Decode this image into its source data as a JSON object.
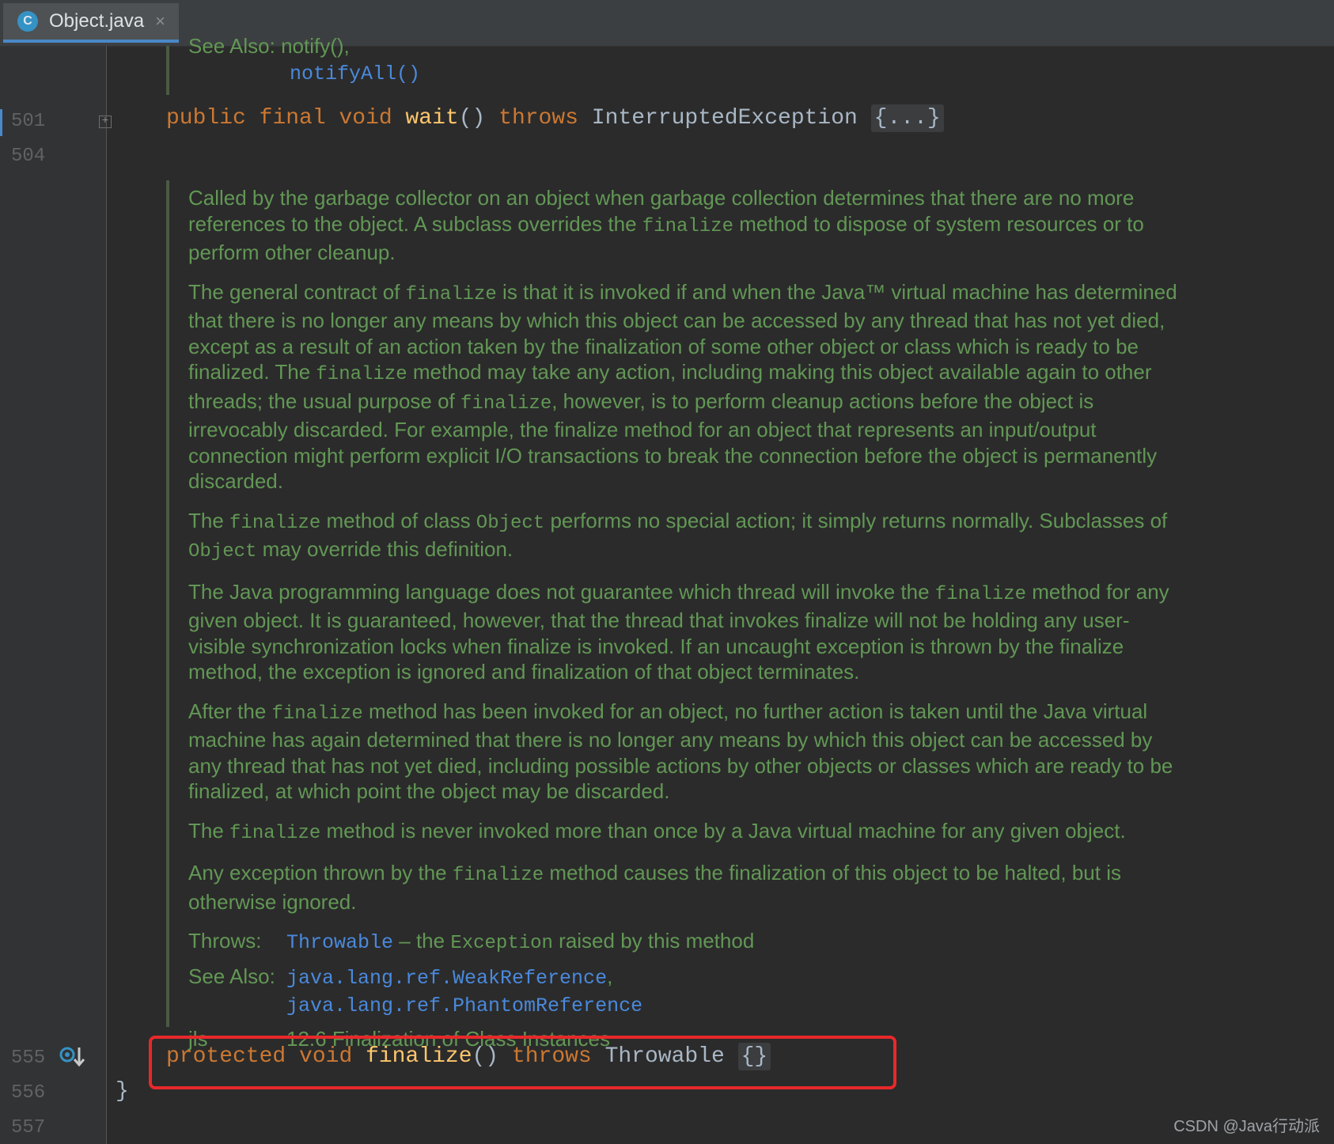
{
  "tab": {
    "icon_letter": "C",
    "title": "Object.java",
    "close": "×"
  },
  "gutter": {
    "lines": [
      "501",
      "504",
      "555",
      "556",
      "557"
    ]
  },
  "top_doc": {
    "see_also_prefix": "See Also: notify(),",
    "notify_all": "notifyAll()"
  },
  "wait_decl": {
    "kw_public": "public",
    "kw_final": "final",
    "kw_void": "void",
    "method": "wait",
    "parens": "()",
    "kw_throws": "throws",
    "exception": "InterruptedException",
    "folded": "{...}"
  },
  "doc": {
    "p1": [
      {
        "t": "Called by the garbage collector on an object when garbage collection determines that there are no more references to the object. A subclass overrides the "
      },
      {
        "c": "finalize"
      },
      {
        "t": " method to dispose of system resources or to perform other cleanup."
      }
    ],
    "p2": [
      {
        "t": "The general contract of "
      },
      {
        "c": "finalize"
      },
      {
        "t": " is that it is invoked if and when the Java™ virtual machine has determined that there is no longer any means by which this object can be accessed by any thread that has not yet died, except as a result of an action taken by the finalization of some other object or class which is ready to be finalized. The "
      },
      {
        "c": "finalize"
      },
      {
        "t": " method may take any action, including making this object available again to other threads; the usual purpose of "
      },
      {
        "c": "finalize"
      },
      {
        "t": ", however, is to perform cleanup actions before the object is irrevocably discarded. For example, the finalize method for an object that represents an input/output connection might perform explicit I/O transactions to break the connection before the object is permanently discarded."
      }
    ],
    "p3": [
      {
        "t": "The "
      },
      {
        "c": "finalize"
      },
      {
        "t": " method of class "
      },
      {
        "c": "Object"
      },
      {
        "t": " performs no special action; it simply returns normally. Subclasses of "
      },
      {
        "c": "Object"
      },
      {
        "t": " may override this definition."
      }
    ],
    "p4": [
      {
        "t": "The Java programming language does not guarantee which thread will invoke the "
      },
      {
        "c": "finalize"
      },
      {
        "t": " method for any given object. It is guaranteed, however, that the thread that invokes finalize will not be holding any user-visible synchronization locks when finalize is invoked. If an uncaught exception is thrown by the finalize method, the exception is ignored and finalization of that object terminates."
      }
    ],
    "p5": [
      {
        "t": "After the "
      },
      {
        "c": "finalize"
      },
      {
        "t": " method has been invoked for an object, no further action is taken until the Java virtual machine has again determined that there is no longer any means by which this object can be accessed by any thread that has not yet died, including possible actions by other objects or classes which are ready to be finalized, at which point the object may be discarded."
      }
    ],
    "p6": [
      {
        "t": "The "
      },
      {
        "c": "finalize"
      },
      {
        "t": " method is never invoked more than once by a Java virtual machine for any given object."
      }
    ],
    "p7": [
      {
        "t": "Any exception thrown by the "
      },
      {
        "c": "finalize"
      },
      {
        "t": " method causes the finalization of this object to be halted, but is otherwise ignored."
      }
    ],
    "throws_label": "Throws:",
    "throws_link": "Throwable",
    "throws_text": " – the ",
    "throws_code": "Exception",
    "throws_rest": " raised by this method",
    "see_also_label": "See Also:",
    "see_also_1": "java.lang.ref.WeakReference",
    "see_also_comma": ",",
    "see_also_2": "java.lang.ref.PhantomReference",
    "jls_label": "jls",
    "jls_text": "12.6 Finalization of Class Instances"
  },
  "finalize_decl": {
    "kw_protected": "protected",
    "kw_void": "void",
    "method": "finalize",
    "parens": "()",
    "kw_throws": "throws",
    "type": "Throwable",
    "body": "{}"
  },
  "closing_brace": "}",
  "watermark": "CSDN @Java行动派",
  "colors": {
    "keyword": "#cc7832",
    "method": "#ffc66d",
    "doc": "#629755",
    "link": "#4a89dc",
    "highlight": "#e8282a"
  }
}
